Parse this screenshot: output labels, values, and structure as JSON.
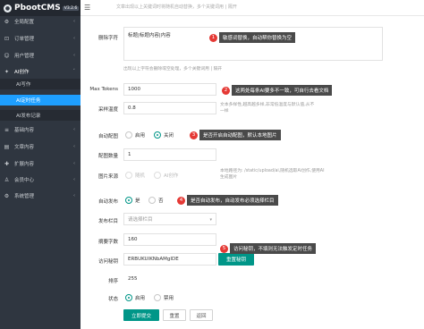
{
  "brand": {
    "name": "PbootCMS",
    "version": "V3.2.6"
  },
  "topbar": {
    "hint": "文章出现以上关键词时将随机自动替换，多个关键词用 | 隔开"
  },
  "sidebar": {
    "items": [
      {
        "label": "全局配置",
        "icon": "gear-icon"
      },
      {
        "label": "订单管理",
        "icon": "cart-icon"
      },
      {
        "label": "用户管理",
        "icon": "user-icon"
      },
      {
        "label": "AI创作",
        "icon": "ai-icon"
      },
      {
        "label": "AI写作"
      },
      {
        "label": "AI定时任务"
      },
      {
        "label": "AI发布记录"
      },
      {
        "label": "基础内容",
        "icon": "list-icon"
      },
      {
        "label": "文章内容",
        "icon": "doc-icon"
      },
      {
        "label": "扩展内容",
        "icon": "puzzle-icon"
      },
      {
        "label": "会员中心",
        "icon": "member-icon"
      },
      {
        "label": "系统管理",
        "icon": "system-icon"
      }
    ]
  },
  "form": {
    "replace_words": {
      "label": "删除字符",
      "value": "标题|标题内容|内容"
    },
    "replace_note": "出现以上字符会删除或空处理，多个关键词用 | 隔开",
    "max_tokens": {
      "label": "Max Tokens",
      "value": "1000"
    },
    "temperature": {
      "label": "采样温度",
      "value": "0.8",
      "note": "文本多样性,越高越多样,非常低温度与默认值,从不一样"
    },
    "auto_image": {
      "label": "自动配图",
      "option_on": "启用",
      "option_off": "关闭"
    },
    "image_count": {
      "label": "配图数量",
      "value": "1"
    },
    "image_source": {
      "label": "图片来源",
      "option_a": "随机",
      "option_b": "AI创作",
      "note": "本地路径为: /static/upload/ai,随机选取Ai创作,使用AI生成图片"
    },
    "auto_publish": {
      "label": "自动发布",
      "option_yes": "是",
      "option_no": "否"
    },
    "publish_column": {
      "label": "发布栏目",
      "placeholder": "请选择栏目"
    },
    "summary_words": {
      "label": "摘要字数",
      "value": "160"
    },
    "access_key": {
      "label": "访问秘钥",
      "value": "ERBUKUIKNbAMgIDE",
      "regen": "重置秘钥"
    },
    "sort": {
      "label": "排序",
      "value": "255"
    },
    "status": {
      "label": "状态",
      "option_on": "启用",
      "option_off": "禁用"
    },
    "buttons": {
      "submit": "立即提交",
      "reset": "重置",
      "back": "返回"
    }
  },
  "callouts": [
    {
      "num": "1",
      "text": "敏感词替换，自动帮你替换为空"
    },
    {
      "num": "2",
      "text": "这两处每条AI要多不一致，可自行去看文档"
    },
    {
      "num": "3",
      "text": "是否开启自动配图，默认本地图片"
    },
    {
      "num": "4",
      "text": "是否自动发布，自动发布必须选择栏目"
    },
    {
      "num": "5",
      "text": "访问秘钥，不填则无法触发定时任务"
    }
  ]
}
